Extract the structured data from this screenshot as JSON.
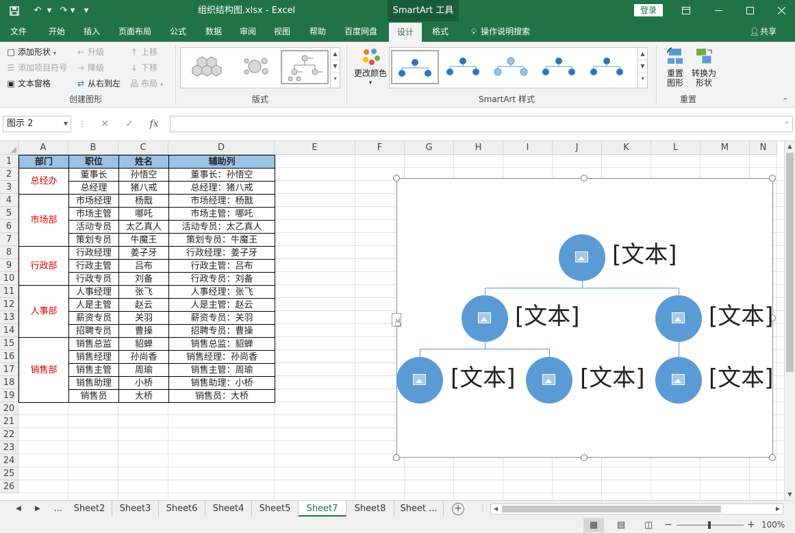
{
  "titlebar": {
    "doc_title": "组织结构图.xlsx  -  Excel",
    "tool_tab": "SmartArt 工具",
    "login": "登录",
    "bg": "#217346"
  },
  "tabs": [
    "文件",
    "开始",
    "插入",
    "页面布局",
    "公式",
    "数据",
    "审阅",
    "视图",
    "帮助",
    "百度网盘",
    "设计",
    "格式"
  ],
  "active_tab": "设计",
  "tell_me": "操作说明搜索",
  "share": "共享",
  "ribbon": {
    "create": {
      "add_shape": "添加形状",
      "add_bullet": "添加项目符号",
      "text_pane": "文本窗格",
      "promote": "升级",
      "demote": "降级",
      "rtl": "从右到左",
      "move_up": "上移",
      "move_down": "下移",
      "layout": "布局",
      "label": "创建图形"
    },
    "layouts_label": "版式",
    "change_colors": "更改颜色",
    "styles_label": "SmartArt 样式",
    "reset_graphic_1": "重置",
    "reset_graphic_2": "图形",
    "convert_1": "转换为",
    "convert_2": "形状",
    "reset_label": "重置"
  },
  "formula": {
    "namebox": "图示 2",
    "fx": "fx",
    "value": ""
  },
  "columns": [
    "A",
    "B",
    "C",
    "D",
    "E",
    "F",
    "G",
    "H",
    "I",
    "J",
    "K",
    "L",
    "M",
    "N"
  ],
  "rows": [
    "1",
    "2",
    "3",
    "4",
    "5",
    "6",
    "7",
    "8",
    "9",
    "10",
    "11",
    "12",
    "13",
    "14",
    "15",
    "16",
    "17",
    "18",
    "19",
    "20",
    "21",
    "22",
    "23",
    "24",
    "25",
    "26"
  ],
  "table": {
    "headers": [
      "部门",
      "职位",
      "姓名",
      "辅助列"
    ],
    "header_color": "#9bc2e6",
    "dept_color": "#e00000",
    "groups": [
      {
        "dept": "总经办",
        "rows": [
          [
            "董事长",
            "孙悟空",
            "董事长：孙悟空"
          ],
          [
            "总经理",
            "猪八戒",
            "总经理：猪八戒"
          ]
        ]
      },
      {
        "dept": "市场部",
        "rows": [
          [
            "市场经理",
            "杨戬",
            "市场经理：杨戬"
          ],
          [
            "市场主管",
            "哪吒",
            "市场主管：哪吒"
          ],
          [
            "活动专员",
            "太乙真人",
            "活动专员：太乙真人"
          ],
          [
            "策划专员",
            "牛魔王",
            "策划专员：牛魔王"
          ]
        ]
      },
      {
        "dept": "行政部",
        "rows": [
          [
            "行政经理",
            "姜子牙",
            "行政经理：姜子牙"
          ],
          [
            "行政主管",
            "吕布",
            "行政主管：吕布"
          ],
          [
            "行政专员",
            "刘备",
            "行政专员：刘备"
          ]
        ]
      },
      {
        "dept": "人事部",
        "rows": [
          [
            "人事经理",
            "张飞",
            "人事经理：张飞"
          ],
          [
            "人是主管",
            "赵云",
            "人是主管：赵云"
          ],
          [
            "薪资专员",
            "关羽",
            "薪资专员：关羽"
          ],
          [
            "招聘专员",
            "曹操",
            "招聘专员：曹操"
          ]
        ]
      },
      {
        "dept": "销售部",
        "rows": [
          [
            "销售总监",
            "貂蝉",
            "销售总监：貂蝉"
          ],
          [
            "销售经理",
            "孙尚香",
            "销售经理：孙尚香"
          ],
          [
            "销售主管",
            "周瑜",
            "销售主管：周瑜"
          ],
          [
            "销售助理",
            "小桥",
            "销售助理：小桥"
          ],
          [
            "销售员",
            "大桥",
            "销售员：大桥"
          ]
        ]
      }
    ]
  },
  "smartart": {
    "node_color": "#5b9bd5",
    "node_text": "[文本]"
  },
  "sheets": [
    "Sheet2",
    "Sheet3",
    "Sheet6",
    "Sheet4",
    "Sheet5",
    "Sheet7",
    "Sheet8",
    "Sheet ..."
  ],
  "active_sheet": "Sheet7",
  "sheet_nav_more": "...",
  "zoom": "100%"
}
